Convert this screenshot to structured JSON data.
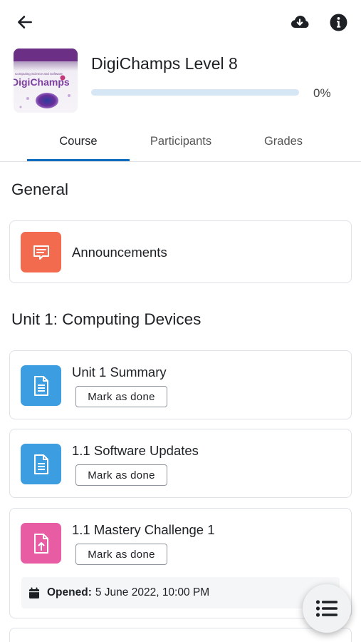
{
  "colors": {
    "accent": "#0f6cbf",
    "announcements_icon_bg": "#f26b4e",
    "page_icon_bg": "#3c9de0",
    "assignment_icon_bg": "#e85ca4"
  },
  "topbar": {
    "back_icon": "arrow-left-icon",
    "download_icon": "cloud-download-icon",
    "info_icon": "info-icon"
  },
  "course": {
    "title": "DigiChamps Level 8",
    "image_text": "DigiChamps",
    "image_subtext": "Computing Science and Software",
    "progress": 0,
    "progress_text": "0%"
  },
  "tabs": [
    {
      "label": "Course",
      "active": true
    },
    {
      "label": "Participants",
      "active": false
    },
    {
      "label": "Grades",
      "active": false
    }
  ],
  "sections": [
    {
      "title": "General",
      "activities": [
        {
          "name": "Announcements",
          "icon": "forum-icon"
        }
      ]
    },
    {
      "title": "Unit 1: Computing Devices",
      "activities": [
        {
          "name": "Unit 1 Summary",
          "icon": "page-icon",
          "button": "Mark as done"
        },
        {
          "name": "1.1 Software Updates",
          "icon": "page-icon",
          "button": "Mark as done"
        },
        {
          "name": "1.1 Mastery Challenge 1",
          "icon": "assignment-icon",
          "button": "Mark as done",
          "dates": {
            "label": "Opened:",
            "value": "5 June 2022, 10:00 PM"
          }
        }
      ]
    }
  ],
  "fab": {
    "icon": "course-index-icon"
  }
}
